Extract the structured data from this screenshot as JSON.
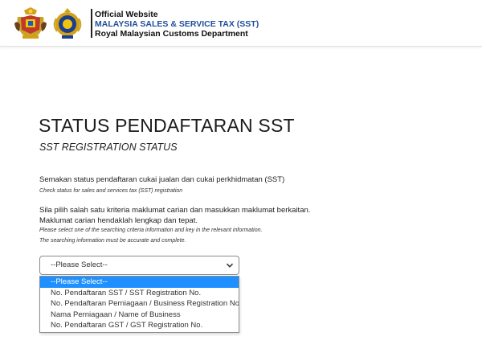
{
  "header": {
    "line1": "Official Website",
    "line2": "MALAYSIA SALES & SERVICE TAX (SST)",
    "line3": "Royal Malaysian Customs Department",
    "logos": [
      "coat-of-arms-icon",
      "customs-crest-icon"
    ]
  },
  "main": {
    "title": "STATUS PENDAFTARAN SST",
    "subtitle": "SST REGISTRATION STATUS",
    "intro_ms": "Semakan status pendaftaran cukai jualan dan cukai perkhidmatan (SST)",
    "intro_en": "Check status for sales and services tax (SST) registration",
    "instr_ms_1": "Sila pilih salah satu kriteria maklumat carian dan masukkan maklumat berkaitan.",
    "instr_ms_2": "Maklumat carian hendaklah lengkap dan tepat.",
    "instr_en_1": "Please select one of the searching criteria information and key in the relevant information.",
    "instr_en_2": "The searching information must be accurate and complete."
  },
  "criteria_select": {
    "selected": "--Please Select--",
    "options": [
      "--Please Select--",
      "No. Pendaftaran SST / SST Registration No.",
      "No. Pendaftaran Perniagaan / Business Registration No.",
      "Nama Perniagaan / Name of Business",
      "No. Pendaftaran GST / GST Registration No."
    ],
    "highlighted_index": 0
  },
  "colors": {
    "brand_blue": "#1f4e9a",
    "highlight": "#1e90ff"
  }
}
